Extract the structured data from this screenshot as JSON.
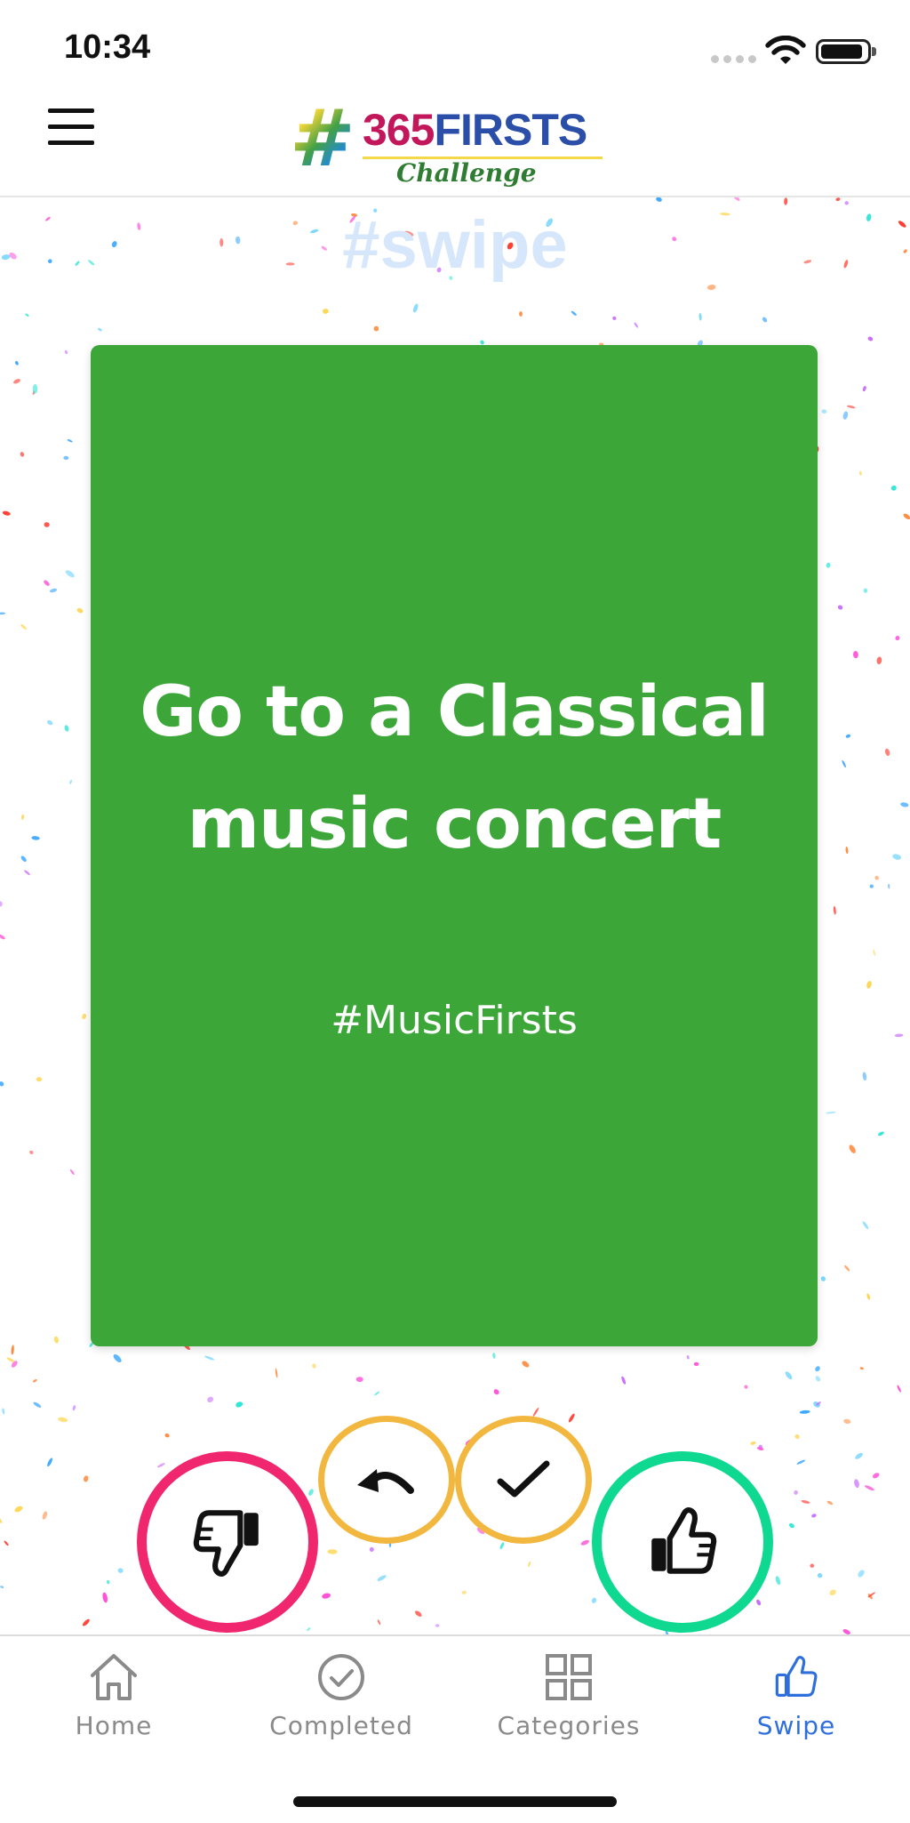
{
  "status_bar": {
    "time": "10:34"
  },
  "header": {
    "logo": {
      "hash": "#",
      "digits": "365",
      "word": "FIRSTS",
      "subtitle": "Challenge"
    }
  },
  "swipe_screen": {
    "title": "#swipe",
    "card": {
      "title": "Go to a Classical music concert",
      "category_tag": "#MusicFirsts",
      "color": "#3ca639"
    },
    "actions": {
      "dislike": {
        "icon": "thumbs-down-icon",
        "color": "#f0266f"
      },
      "undo": {
        "icon": "undo-icon",
        "color": "#f2b73f"
      },
      "done": {
        "icon": "checkmark-icon",
        "color": "#f2b73f"
      },
      "like": {
        "icon": "thumbs-up-icon",
        "color": "#0fd890"
      }
    }
  },
  "tab_bar": {
    "active_color": "#2f6fdc",
    "tabs": [
      {
        "label": "Home",
        "icon": "home-icon"
      },
      {
        "label": "Completed",
        "icon": "check-circle-icon"
      },
      {
        "label": "Categories",
        "icon": "grid-icon"
      },
      {
        "label": "Swipe",
        "icon": "thumbs-up-icon",
        "active": true
      }
    ]
  }
}
